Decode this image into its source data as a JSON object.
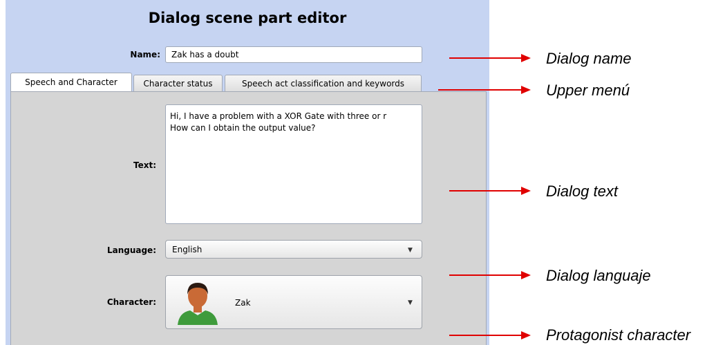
{
  "editor": {
    "title": "Dialog scene part editor",
    "name_label": "Name:",
    "name_value": "Zak has a doubt",
    "tabs": [
      {
        "label": "Speech and Character",
        "active": true
      },
      {
        "label": "Character status",
        "active": false
      },
      {
        "label": "Speech act classification and keywords",
        "active": false
      }
    ],
    "text_label": "Text:",
    "text_lines": [
      "Hi, I have a problem with a XOR Gate with three or r",
      "How can I obtain the output value?"
    ],
    "language_label": "Language:",
    "language_value": "English",
    "character_label": "Character:",
    "character_value": "Zak",
    "colors": {
      "background": "#c6d4f2",
      "panel": "#d5d5d5",
      "arrow": "#e00000"
    }
  },
  "annotations": {
    "dialog_name": "Dialog name",
    "upper_menu": "Upper menú",
    "dialog_text": "Dialog text",
    "dialog_language": "Dialog languaje",
    "protagonist_character": "Protagonist character"
  },
  "icons": {
    "avatar": "character-avatar-icon",
    "dropdown": "chevron-down-icon",
    "arrow": "red-arrow-icon"
  }
}
